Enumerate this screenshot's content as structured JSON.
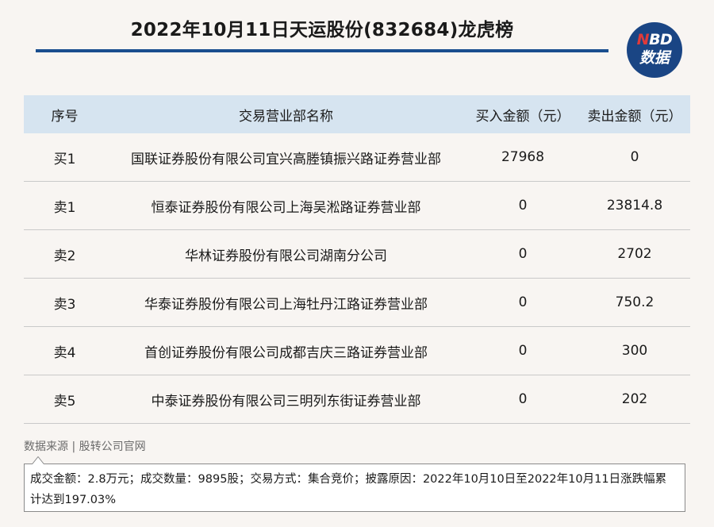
{
  "header": {
    "title": "2022年10月11日天运股份(832684)龙虎榜"
  },
  "logo": {
    "line1_n": "N",
    "line1_rest": "BD",
    "line2": "数据"
  },
  "table": {
    "columns": [
      "序号",
      "交易营业部名称",
      "买入金额（元）",
      "卖出金额（元）"
    ],
    "rows": [
      {
        "seq": "买1",
        "name": "国联证券股份有限公司宜兴高塍镇振兴路证券营业部",
        "buy": "27968",
        "sell": "0"
      },
      {
        "seq": "卖1",
        "name": "恒泰证券股份有限公司上海吴淞路证券营业部",
        "buy": "0",
        "sell": "23814.8"
      },
      {
        "seq": "卖2",
        "name": "华林证券股份有限公司湖南分公司",
        "buy": "0",
        "sell": "2702"
      },
      {
        "seq": "卖3",
        "name": "华泰证券股份有限公司上海牡丹江路证券营业部",
        "buy": "0",
        "sell": "750.2"
      },
      {
        "seq": "卖4",
        "name": "首创证券股份有限公司成都吉庆三路证券营业部",
        "buy": "0",
        "sell": "300"
      },
      {
        "seq": "卖5",
        "name": "中泰证券股份有限公司三明列东街证券营业部",
        "buy": "0",
        "sell": "202"
      }
    ]
  },
  "footer": {
    "source": "数据来源 | 股转公司官网",
    "note": "成交金额：2.8万元；成交数量：9895股；交易方式：集合竞价；披露原因：2022年10月10日至2022年10月11日涨跌幅累计达到197.03%"
  },
  "colors": {
    "accent": "#1a4e8f",
    "header_bg": "#d6e4f0",
    "page_bg": "#f8f5f2",
    "logo_bg": "#1a4584",
    "logo_n": "#e03a3a"
  }
}
